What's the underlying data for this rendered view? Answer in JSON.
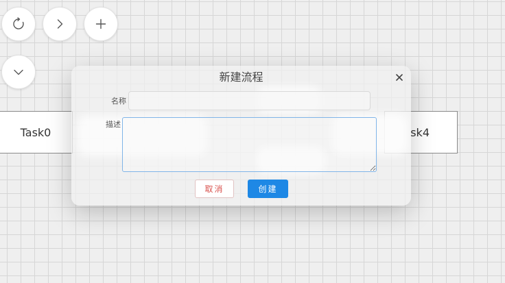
{
  "toolbar": {
    "refresh_icon": "refresh-icon",
    "next_icon": "chevron-right-icon",
    "add_icon": "plus-icon",
    "expand_icon": "chevron-down-icon"
  },
  "canvas": {
    "tasks": [
      {
        "label": "Task0"
      },
      {
        "label": "sk4"
      }
    ]
  },
  "dialog": {
    "title": "新建流程",
    "name_label": "名称",
    "name_value": "",
    "desc_label": "描述",
    "desc_value": "",
    "cancel_label": "取消",
    "create_label": "创建",
    "close_icon": "close-icon"
  },
  "colors": {
    "accent": "#1e88e5",
    "cancel_text": "#d9534f",
    "focus_border": "#7fb4e8"
  }
}
